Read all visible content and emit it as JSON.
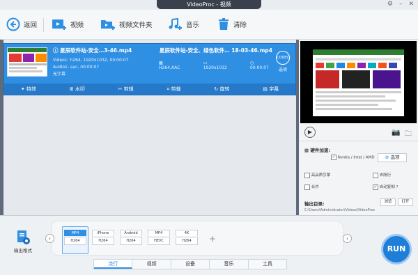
{
  "window": {
    "title": "VideoProc - 视频"
  },
  "toolbar": {
    "back": "返回",
    "video": "视频",
    "video_folder": "视频文件夹",
    "music": "音乐",
    "clear": "清除"
  },
  "item": {
    "source_name": "星辰软件站-安全…3-46.mp4",
    "source_video": "Video1: h264, 1920x1032, 00:00:07",
    "source_audio": "Audio1: aac, 00:00:07",
    "subtitle": "无字幕",
    "output_name": "星辰软件站-安全、绿色软件… 18-03-46.mp4",
    "output_codec": "H264,AAC",
    "output_res": "1920x1032",
    "output_dur": "00:00:07",
    "codec_badge": "CODEC",
    "codec_option": "选项",
    "edit_actions": [
      "特效",
      "水印",
      "剪辑",
      "剪裁",
      "旋转",
      "字幕"
    ]
  },
  "settings": {
    "hw_title": "硬件加速:",
    "hw_option": "Nvidia / Intel / AMD",
    "options_btn": "选项",
    "high_quality": "高品质引擎",
    "deinterlace": "去隔行",
    "merge": "合并",
    "auto_copy": "自动复制",
    "help": "?",
    "output_dir_label": "输出目录:",
    "browse": "浏览",
    "open": "打开",
    "output_path": "C:\\Users\\Administrator\\Videos\\VideoProc"
  },
  "bottom": {
    "output_format_label": "输出格式",
    "formats": [
      {
        "top": "MP4",
        "bottom": "H264"
      },
      {
        "top": "iPhone",
        "bottom": "H264"
      },
      {
        "top": "Android",
        "bottom": "H264"
      },
      {
        "top": "MP4",
        "bottom": "HEVC"
      },
      {
        "top": "4K",
        "bottom": "H264"
      }
    ],
    "tabs": [
      "流行",
      "视频",
      "设备",
      "音乐",
      "工具"
    ],
    "run": "RUN"
  }
}
